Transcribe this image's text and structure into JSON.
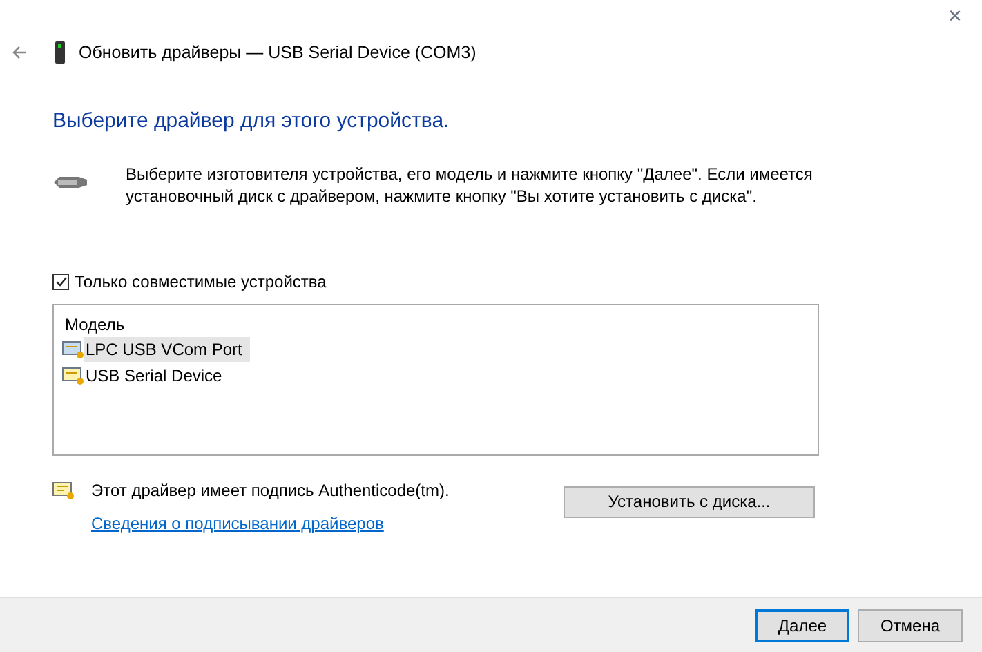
{
  "window": {
    "title": "Обновить драйверы — USB Serial Device (COM3)",
    "close": "✕"
  },
  "heading": "Выберите драйвер для этого устройства.",
  "description": "Выберите изготовителя устройства, его модель и нажмите кнопку \"Далее\". Если имеется установочный диск с драйвером, нажмите кнопку \"Вы хотите установить с диска\".",
  "compatible_checkbox": {
    "label": "Только совместимые устройства",
    "checked": true
  },
  "model_list": {
    "header": "Модель",
    "items": [
      {
        "label": "LPC USB VCom Port",
        "selected": true
      },
      {
        "label": "USB Serial Device",
        "selected": false
      }
    ]
  },
  "signature": {
    "text": "Этот драйвер имеет подпись Authenticode(tm).",
    "link": "Сведения о подписывании драйверов"
  },
  "install_button": "Установить с диска...",
  "buttons": [
    {
      "label": "Далее",
      "default": true
    },
    {
      "label": "Отмена",
      "default": false
    }
  ]
}
